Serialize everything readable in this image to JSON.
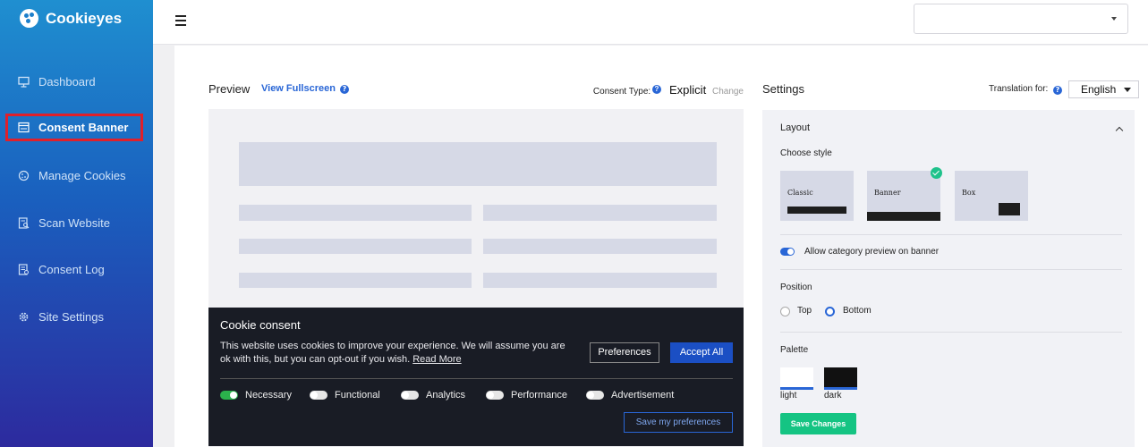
{
  "app": {
    "name": "Cookieyes"
  },
  "sidebar": {
    "items": [
      {
        "label": "Dashboard",
        "icon": "monitor-icon"
      },
      {
        "label": "Consent Banner",
        "icon": "window-icon",
        "active": true
      },
      {
        "label": "Manage Cookies",
        "icon": "cookie-icon"
      },
      {
        "label": "Scan Website",
        "icon": "scan-icon"
      },
      {
        "label": "Consent Log",
        "icon": "log-icon"
      },
      {
        "label": "Site Settings",
        "icon": "gear-icon"
      }
    ]
  },
  "topbar": {
    "site_select_value": ""
  },
  "preview": {
    "title": "Preview",
    "view_fullscreen": "View Fullscreen",
    "consent_type_label": "Consent Type:",
    "consent_type_value": "Explicit",
    "change_link": "Change"
  },
  "cookie_banner": {
    "title": "Cookie consent",
    "text": "This website uses cookies to improve your experience. We will assume you are ok with this, but you can opt-out if you wish.",
    "read_more": "Read More",
    "preferences_button": "Preferences",
    "accept_button": "Accept All",
    "categories": [
      {
        "label": "Necessary",
        "enabled": true
      },
      {
        "label": "Functional",
        "enabled": false
      },
      {
        "label": "Analytics",
        "enabled": false
      },
      {
        "label": "Performance",
        "enabled": false
      },
      {
        "label": "Advertisement",
        "enabled": false
      }
    ],
    "save_button": "Save my preferences"
  },
  "settings": {
    "title": "Settings",
    "translation_label": "Translation for:",
    "language": "English",
    "layout_heading": "Layout",
    "choose_style_label": "Choose style",
    "styles": [
      {
        "label": "Classic",
        "selected": false
      },
      {
        "label": "Banner",
        "selected": true
      },
      {
        "label": "Box",
        "selected": false
      }
    ],
    "category_preview_label": "Allow category preview on banner",
    "category_preview_enabled": true,
    "position_label": "Position",
    "positions": [
      {
        "label": "Top",
        "selected": false
      },
      {
        "label": "Bottom",
        "selected": true
      }
    ],
    "palette_label": "Palette",
    "palettes": [
      {
        "label": "light",
        "color": "#ffffff"
      },
      {
        "label": "dark",
        "color": "#111111"
      }
    ],
    "save_button": "Save Changes"
  },
  "colors": {
    "accent": "#2966d6",
    "success": "#15c483",
    "banner_bg": "#191c25",
    "active_outline": "#e0202a"
  }
}
